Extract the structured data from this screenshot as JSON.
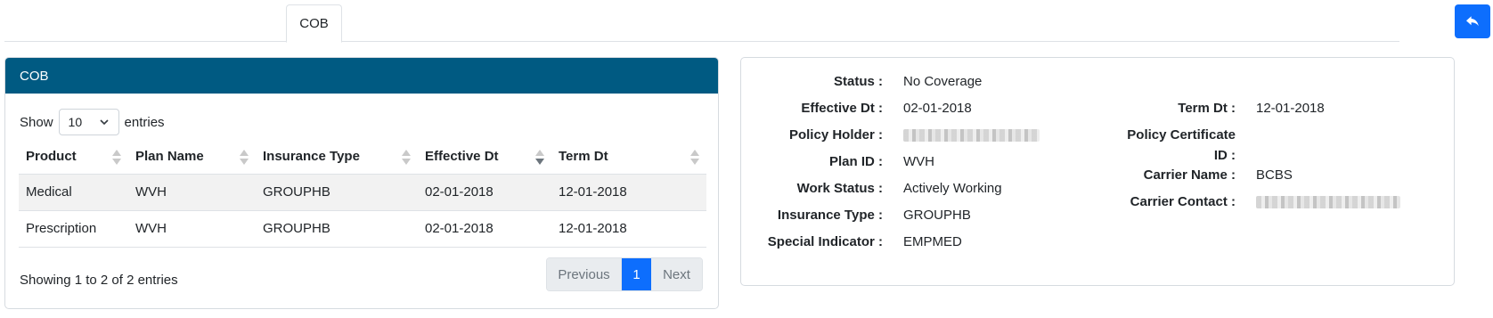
{
  "tabs": [
    {
      "label": "COB"
    }
  ],
  "cob_card": {
    "title": "COB",
    "length": {
      "prefix": "Show",
      "value": "10",
      "suffix": "entries"
    },
    "columns": [
      "Product",
      "Plan Name",
      "Insurance Type",
      "Effective Dt",
      "Term Dt"
    ],
    "rows": [
      [
        "Medical",
        "WVH",
        "GROUPHB",
        "02-01-2018",
        "12-01-2018"
      ],
      [
        "Prescription",
        "WVH",
        "GROUPHB",
        "02-01-2018",
        "12-01-2018"
      ]
    ],
    "info": "Showing 1 to 2 of 2 entries",
    "pagination": {
      "previous": "Previous",
      "current": "1",
      "next": "Next"
    }
  },
  "details": {
    "status": {
      "label": "Status :",
      "value": "No Coverage"
    },
    "effective_dt": {
      "label": "Effective Dt :",
      "value": "02-01-2018"
    },
    "term_dt": {
      "label": "Term Dt :",
      "value": "12-01-2018"
    },
    "policy_holder": {
      "label": "Policy Holder :"
    },
    "policy_certificate_id": {
      "label_line1": "Policy Certificate",
      "label_line2": "ID :"
    },
    "plan_id": {
      "label": "Plan ID :",
      "value": "WVH"
    },
    "carrier_name": {
      "label": "Carrier Name :",
      "value": "BCBS"
    },
    "work_status": {
      "label": "Work Status :",
      "value": "Actively Working"
    },
    "carrier_contact": {
      "label": "Carrier Contact :"
    },
    "insurance_type": {
      "label": "Insurance Type :",
      "value": "GROUPHB"
    },
    "special_indicator": {
      "label": "Special Indicator :",
      "value": "EMPMED"
    }
  },
  "icons": {
    "back": "reply-arrow-icon",
    "dropdown": "chevron-down-icon",
    "sort": "sort-arrows-icon"
  },
  "colors": {
    "header": "#005a82",
    "primary": "#0d6efd"
  }
}
